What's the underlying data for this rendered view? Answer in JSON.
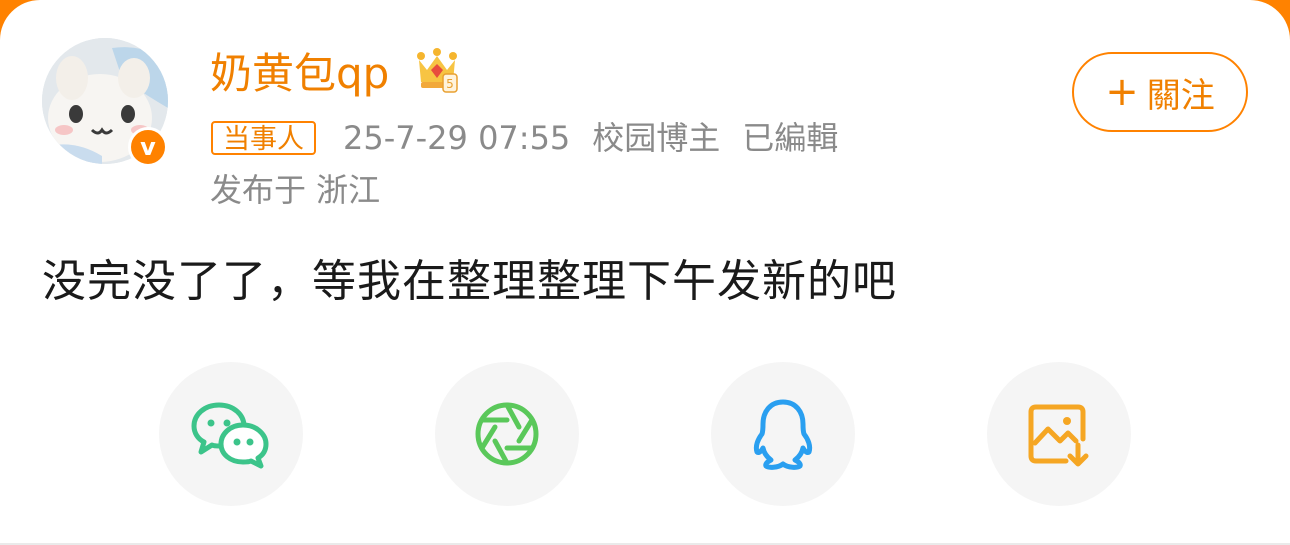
{
  "post": {
    "author": {
      "name": "奶黄包qp",
      "verified_badge": "v",
      "role_badge": "当事人"
    },
    "meta": {
      "timestamp": "25-7-29 07:55",
      "author_type": "校园博主",
      "edited": "已編輯",
      "location": "发布于 浙江"
    },
    "follow_button": {
      "plus": "+",
      "label": "關注"
    },
    "text": "没完没了了，等我在整理整理下午发新的吧"
  },
  "share_targets": [
    {
      "name": "WeChat",
      "icon": "wechat-icon",
      "color": "#3cc48a"
    },
    {
      "name": "Moments",
      "icon": "moments-icon",
      "color": "#5ac85a"
    },
    {
      "name": "QQ",
      "icon": "qq-icon",
      "color": "#2a9ff0"
    },
    {
      "name": "Save image",
      "icon": "save-image-icon",
      "color": "#f5a623"
    }
  ],
  "colors": {
    "accent": "#ff8200",
    "name": "#f08000",
    "meta": "#8a8a8a",
    "text": "#1a1a1a"
  }
}
